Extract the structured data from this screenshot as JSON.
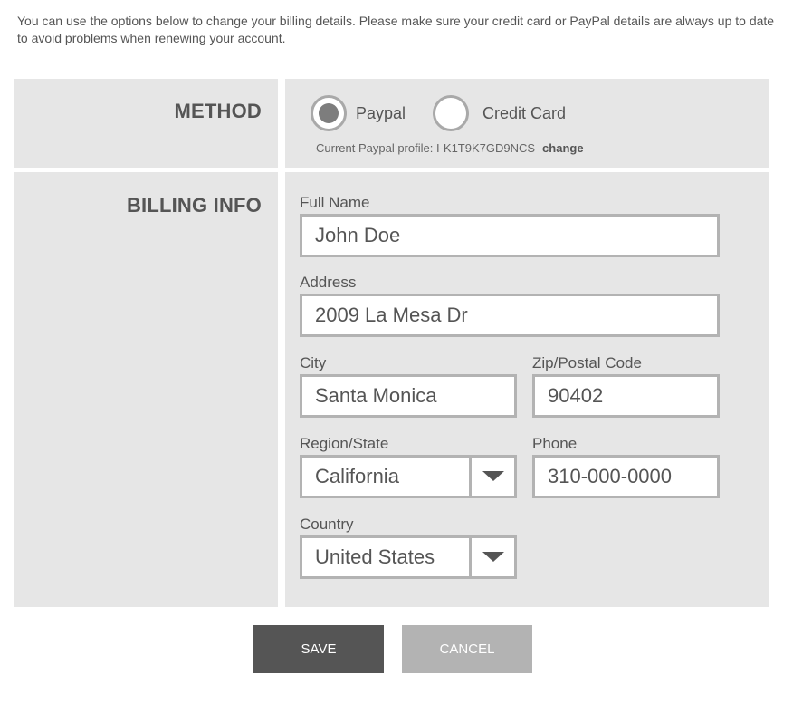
{
  "intro_text": "You can use the options below to change your billing details. Please make sure your credit card or PayPal details are always up to date to avoid problems when renewing your account.",
  "method": {
    "heading": "METHOD",
    "options": [
      {
        "label": "Paypal",
        "selected": true
      },
      {
        "label": "Credit Card",
        "selected": false
      }
    ],
    "profile_text": "Current Paypal profile: I-K1T9K7GD9NCS",
    "change_label": "change"
  },
  "billing": {
    "heading": "BILLING INFO",
    "full_name": {
      "label": "Full Name",
      "value": "John Doe"
    },
    "address": {
      "label": "Address",
      "value": "2009 La Mesa Dr"
    },
    "city": {
      "label": "City",
      "value": "Santa Monica"
    },
    "zip": {
      "label": "Zip/Postal Code",
      "value": "90402"
    },
    "region": {
      "label": "Region/State",
      "value": "California"
    },
    "phone": {
      "label": "Phone",
      "value": "310-000-0000"
    },
    "country": {
      "label": "Country",
      "value": "United States"
    }
  },
  "buttons": {
    "save": "SAVE",
    "cancel": "CANCEL"
  },
  "colors": {
    "panel": "#e6e6e6",
    "save_button": "#555555",
    "cancel_button": "#b3b3b3",
    "field_border": "#b3b3b3"
  }
}
